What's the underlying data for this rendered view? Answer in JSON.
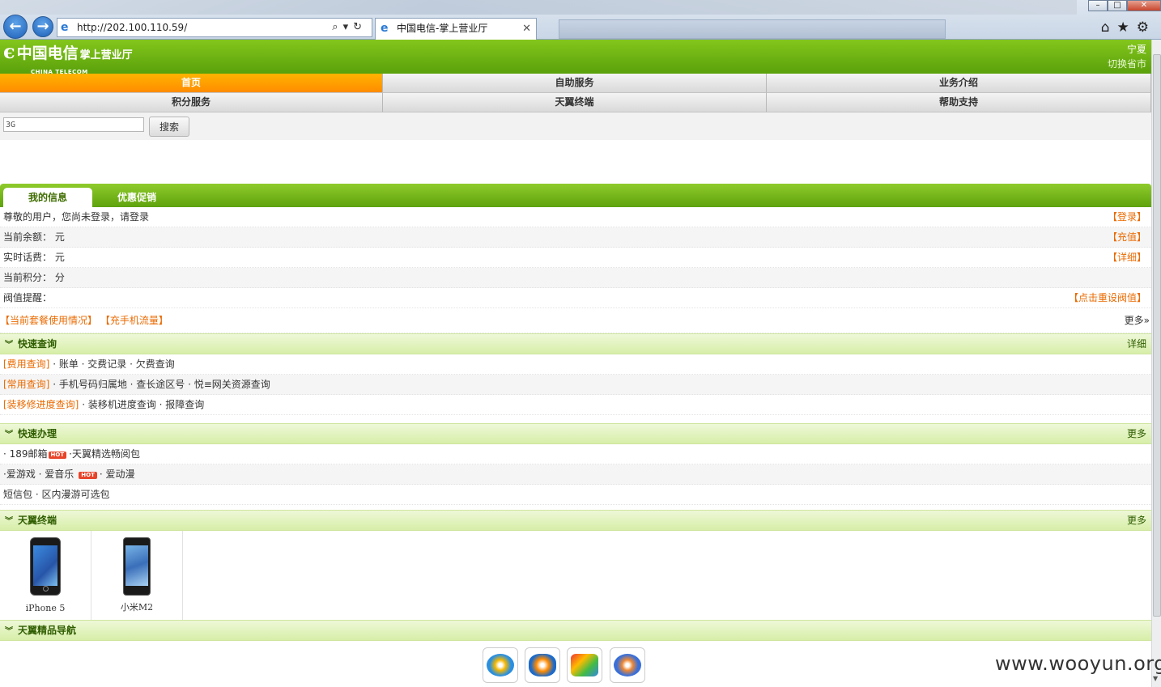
{
  "browser": {
    "url": "http://202.100.110.59/",
    "tab_title": "中国电信-掌上营业厅",
    "back_icon": "arrow-left-icon",
    "forward_icon": "arrow-right-icon"
  },
  "header": {
    "logo_cn": "中国电信",
    "logo_sub": "掌上营业厅",
    "logo_en": "CHINA TELECOM",
    "province": "宁夏",
    "switch_province": "切换省市"
  },
  "nav": {
    "row1": [
      "首页",
      "自助服务",
      "业务介绍"
    ],
    "row2": [
      "积分服务",
      "天翼终端",
      "帮助支持"
    ]
  },
  "search": {
    "value": "3G",
    "button": "搜索"
  },
  "info_tabs": [
    "我的信息",
    "优惠促销"
  ],
  "info": {
    "greeting": "尊敬的用户，您尚未登录，请登录",
    "login": "【登录】",
    "balance": "当前余额： 元",
    "recharge": "【充值】",
    "realtime": "实时话费： 元",
    "detail": "【详细】",
    "points": "当前积分： 分",
    "threshold": "阀值提醒：",
    "reset_threshold": "【点击重设阀值】",
    "package_usage": "【当前套餐使用情况】",
    "phone_flow": "【充手机流量】",
    "more": "更多"
  },
  "quick_query": {
    "title": "快速查询",
    "right": "详细",
    "rows": [
      {
        "cat": "[费用查询]",
        "items": "· 账单 · 交费记录 · 欠费查询"
      },
      {
        "cat": "[常用查询]",
        "items": "· 手机号码归属地 · 查长途区号 · 悦≡网关资源查询"
      },
      {
        "cat": "[装移修进度查询]",
        "items": "· 装移机进度查询 · 报障查询"
      }
    ]
  },
  "quick_handle": {
    "title": "快速办理",
    "right": "更多",
    "row1_a": "· 189邮箱",
    "row1_b": "·天翼精选畅阅包",
    "row2_a": "·爱游戏 · 爱音乐",
    "row2_b": "· 爱动漫",
    "row3": "短信包 · 区内漫游可选包",
    "hot": "HOT"
  },
  "terminals": {
    "title": "天翼终端",
    "right": "更多",
    "phones": [
      "iPhone 5",
      "小米M2"
    ]
  },
  "boutique": {
    "title": "天翼精品导航",
    "apps": [
      "music-app-icon",
      "video-app-icon",
      "shopping-app-icon",
      "game-app-icon"
    ]
  },
  "watermark": "www.wooyun.org",
  "colors": {
    "brand_green": "#6fb514",
    "active_orange": "#ff9a00",
    "link_orange": "#ea6a00"
  }
}
